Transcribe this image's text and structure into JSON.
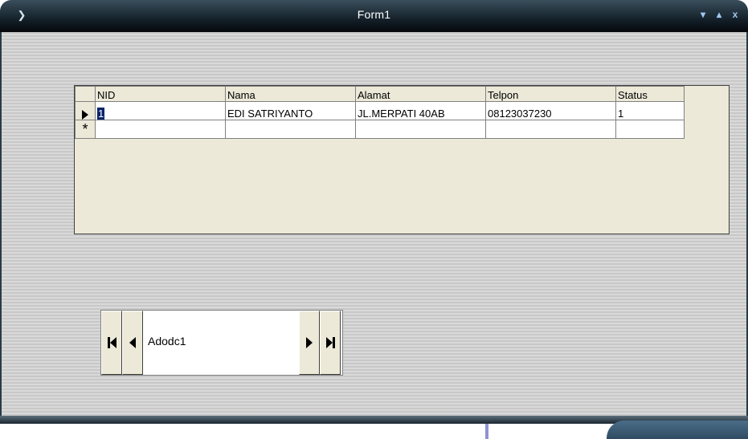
{
  "window": {
    "title": "Form1",
    "system_icon": "app-menu-icon",
    "controls": [
      {
        "name": "minimize",
        "glyph": "▾"
      },
      {
        "name": "maximize",
        "glyph": "▴"
      },
      {
        "name": "close",
        "glyph": "x"
      }
    ]
  },
  "grid": {
    "columns": [
      "NID",
      "Nama",
      "Alamat",
      "Telpon",
      "Status"
    ],
    "rows": [
      {
        "selector": "current-row",
        "cells": [
          "1",
          "EDI SATRIYANTO",
          "JL.MERPATI 40AB",
          "08123037230",
          "1"
        ]
      },
      {
        "selector": "new-row",
        "cells": [
          "",
          "",
          "",
          "",
          ""
        ]
      }
    ],
    "new_row_glyph": "*"
  },
  "adodc": {
    "caption": "Adodc1",
    "buttons": [
      "move-first",
      "move-previous",
      "move-next",
      "move-last"
    ]
  }
}
